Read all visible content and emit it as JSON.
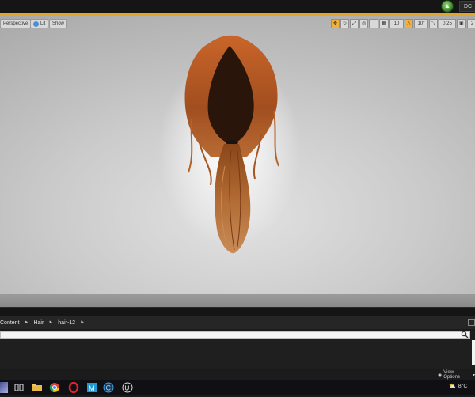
{
  "titlebar": {
    "tab_label": "DC"
  },
  "viewport": {
    "perspective_label": "Perspective",
    "lit_label": "Lit",
    "show_label": "Show",
    "grid_snap_value": "10",
    "rotation_snap_value": "10°",
    "scale_snap_value": "0.25",
    "camera_speed_value": "2"
  },
  "content_browser": {
    "breadcrumb": [
      "Content",
      "Hair",
      "hair-12"
    ],
    "search_placeholder": "",
    "view_options_label": "View Options"
  },
  "taskbar": {
    "weather": "8°C",
    "apps": [
      "start-icon",
      "task-view-icon",
      "file-explorer-icon",
      "chrome-icon",
      "opera-icon",
      "app-m-icon",
      "app-c-icon",
      "unreal-engine-icon"
    ]
  },
  "colors": {
    "accent": "#e1a52a",
    "hair": "#b85a24"
  }
}
